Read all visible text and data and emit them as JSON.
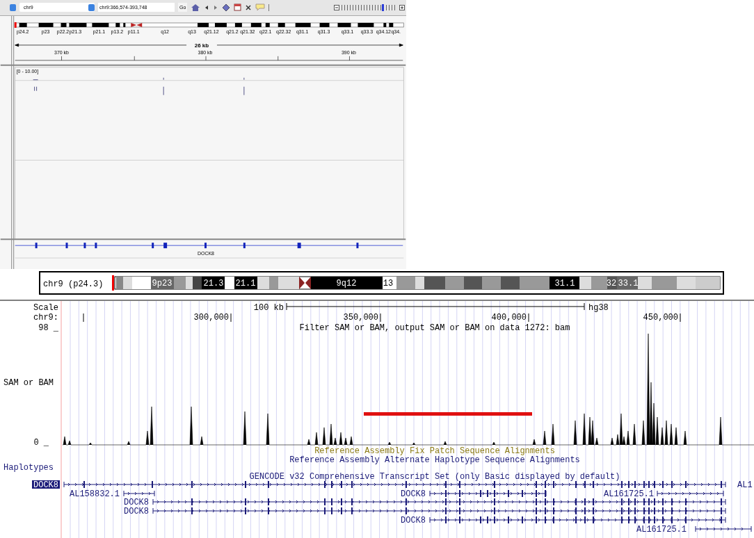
{
  "igv": {
    "toolbar": {
      "chromosome": "chr9",
      "locus": "chr9:366,574-393,748",
      "go": "Go",
      "zoom": {
        "level": 0.72
      }
    },
    "bands": [
      "p24.2",
      "p23",
      "p22.2",
      "p21.3",
      "p21.1",
      "p13.2",
      "p11.1",
      "q12",
      "q13",
      "q21.12",
      "q21.2",
      "q21.32",
      "q22.1",
      "q22.32",
      "q31.1",
      "q31.3",
      "q33.1",
      "q33.3",
      "q34.12",
      "q34."
    ],
    "span": "26 kb",
    "ruler_labels": [
      "370 kb",
      "380 kb",
      "390 kb"
    ],
    "track_range": "[0 - 10.00]",
    "gene": "DOCK8"
  },
  "ucsc": {
    "chromosome_label": "chr9 (p24.3)",
    "bands": [
      "9p23",
      "21.3",
      "21.1",
      "9q12",
      "13",
      "31.1",
      "32",
      "33.1"
    ],
    "scale": {
      "label": "Scale",
      "length": "100 kb",
      "assembly": "hg38"
    },
    "position": {
      "label": "chr9:",
      "ticks": [
        "300,000",
        "350,000",
        "400,000",
        "450,000"
      ]
    },
    "coverage": {
      "max": "98 _",
      "min": "0 _",
      "title": "Filter SAM or BAM, output SAM or BAM on data 1272: bam",
      "label": "SAM or BAM"
    },
    "tracks": [
      {
        "title": "Reference Assembly Fix Patch Sequence Alignments",
        "color": "#8c7b14"
      },
      {
        "title": "Reference Assembly Alternate Haplotype Sequence Alignments",
        "color": "#1a1a78"
      }
    ],
    "haplotypes": "Haplotypes",
    "gencode_title": "GENCODE v32 Comprehensive Transcript Set (only Basic displayed by default)",
    "transcripts": [
      {
        "label": "DOCK8",
        "selected": true
      },
      {
        "label": "AL1",
        "selected": false
      },
      {
        "label": "AL158832.1",
        "selected": false
      },
      {
        "label": "DOCK8",
        "selected": false
      },
      {
        "label": "AL161725.1",
        "selected": false
      },
      {
        "label": "DOCK8",
        "selected": false
      },
      {
        "label": "DOCK8",
        "selected": false
      },
      {
        "label": "DOCK8",
        "selected": false
      },
      {
        "label": "AL161725.1",
        "selected": false
      }
    ]
  }
}
